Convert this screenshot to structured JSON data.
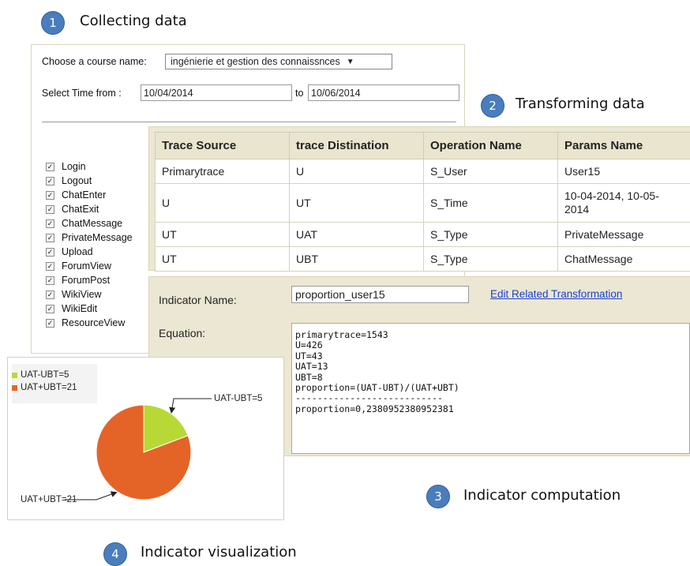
{
  "steps": [
    {
      "number": "1",
      "label": "Collecting data"
    },
    {
      "number": "2",
      "label": "Transforming data"
    },
    {
      "number": "3",
      "label": "Indicator computation"
    },
    {
      "number": "4",
      "label": "Indicator visualization"
    }
  ],
  "collect": {
    "course_label": "Choose a course name:",
    "course_value": "ingénierie et gestion des connaissnces",
    "dropdown_arrow": "▼",
    "time_from_label": "Select Time from :",
    "time_from_value": "10/04/2014",
    "time_to_label": "to",
    "time_to_value": "10/06/2014",
    "events": [
      {
        "label": "Login",
        "checked": true
      },
      {
        "label": "Logout",
        "checked": true
      },
      {
        "label": "ChatEnter",
        "checked": true
      },
      {
        "label": "ChatExit",
        "checked": true
      },
      {
        "label": "ChatMessage",
        "checked": true
      },
      {
        "label": "PrivateMessage",
        "checked": true
      },
      {
        "label": "Upload",
        "checked": true
      },
      {
        "label": "ForumView",
        "checked": true
      },
      {
        "label": "ForumPost",
        "checked": true
      },
      {
        "label": "WikiView",
        "checked": true
      },
      {
        "label": "WikiEdit",
        "checked": true
      },
      {
        "label": "ResourceView",
        "checked": true
      }
    ]
  },
  "transform": {
    "headers": [
      "Trace Source",
      "trace Distination",
      "Operation Name",
      "Params Name"
    ],
    "rows": [
      [
        "Primarytrace",
        "U",
        "S_User",
        "User15"
      ],
      [
        "U",
        "UT",
        "S_Time",
        "10-04-2014, 10-05-2014"
      ],
      [
        "UT",
        "UAT",
        "S_Type",
        "PrivateMessage"
      ],
      [
        "UT",
        "UBT",
        "S_Type",
        "ChatMessage"
      ]
    ]
  },
  "indicator": {
    "name_label": "Indicator Name:",
    "name_value": "proportion_user15",
    "edit_link": "Edit Related Transformation",
    "equation_label": "Equation:",
    "equation_lines": [
      "primarytrace=1543",
      "U=426",
      "UT=43",
      "UAT=13",
      "UBT=8",
      "proportion=(UAT-UBT)/(UAT+UBT)",
      "---------------------------",
      "proportion=0,2380952380952381"
    ]
  },
  "chart_data": {
    "type": "pie",
    "slices": [
      {
        "label": "UAT-UBT=5",
        "value": 5,
        "color": "#b8d935"
      },
      {
        "label": "UAT+UBT=21",
        "value": 21,
        "color": "#e46428"
      }
    ],
    "legend": [
      "UAT-UBT=5",
      "UAT+UBT=21"
    ],
    "legend_position": "top-left"
  },
  "colors": {
    "step_circle": "#4a7dbd",
    "panel_bg": "#ebe7d3",
    "link": "#1a3fd0"
  }
}
